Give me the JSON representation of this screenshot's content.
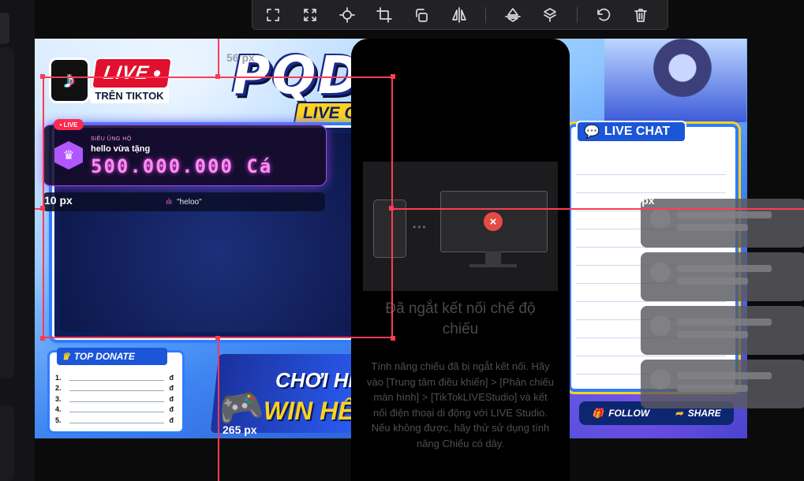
{
  "toolbar": {
    "buttons": [
      {
        "name": "fit-icon"
      },
      {
        "name": "fullscreen-icon"
      },
      {
        "name": "center-icon"
      },
      {
        "name": "crop-icon"
      },
      {
        "name": "rotate-copy-icon"
      },
      {
        "name": "flip-horizontal-icon"
      },
      {
        "name": "flip-vertical-icon"
      },
      {
        "name": "rotate-icon"
      },
      {
        "name": "undo-icon"
      },
      {
        "name": "delete-icon"
      }
    ]
  },
  "overlay": {
    "live_badge": "LIVE",
    "tren_tiktok": "TRÊN TIKTOK",
    "brand_title": "PQD",
    "live_game": "LIVE GA",
    "gift": {
      "tag": "• LIVE",
      "subtitle": "SIÊU ỦNG HỘ",
      "user_line": "hello vừa tặng",
      "amount": "500.000.000 Cá"
    },
    "comment": "\"heloo\"",
    "top_donate": {
      "title": "TOP DONATE",
      "rows": [
        {
          "num": "1.",
          "cur": "đ"
        },
        {
          "num": "2.",
          "cur": "đ"
        },
        {
          "num": "3.",
          "cur": "đ"
        },
        {
          "num": "4.",
          "cur": "đ"
        },
        {
          "num": "5.",
          "cur": "đ"
        }
      ]
    },
    "promo_line1": "CHƠI HẾ",
    "promo_line2": "WIN HẾ",
    "live_chat": "LIVE CHAT",
    "follow": "FOLLOW",
    "share": "SHARE"
  },
  "mirror_panel": {
    "title": "Đã ngắt kết nối chế độ chiếu",
    "body": "Tính năng chiếu đã bị ngắt kết nối. Hãy vào [Trung tâm điều khiển] > [Phản chiếu màn hình] > [TikTokLIVEStudio] và kết nối điện thoại di động với LIVE Studio. Nếu không được, hãy thử sử dụng tính năng Chiếu có dây."
  },
  "measurements": {
    "top": "56 px",
    "left": "10 px",
    "right": "738 px",
    "bottom": "265 px"
  },
  "colors": {
    "selection": "#ff3b55",
    "accent_blue": "#2f7dff",
    "error_red": "#e54b45"
  }
}
